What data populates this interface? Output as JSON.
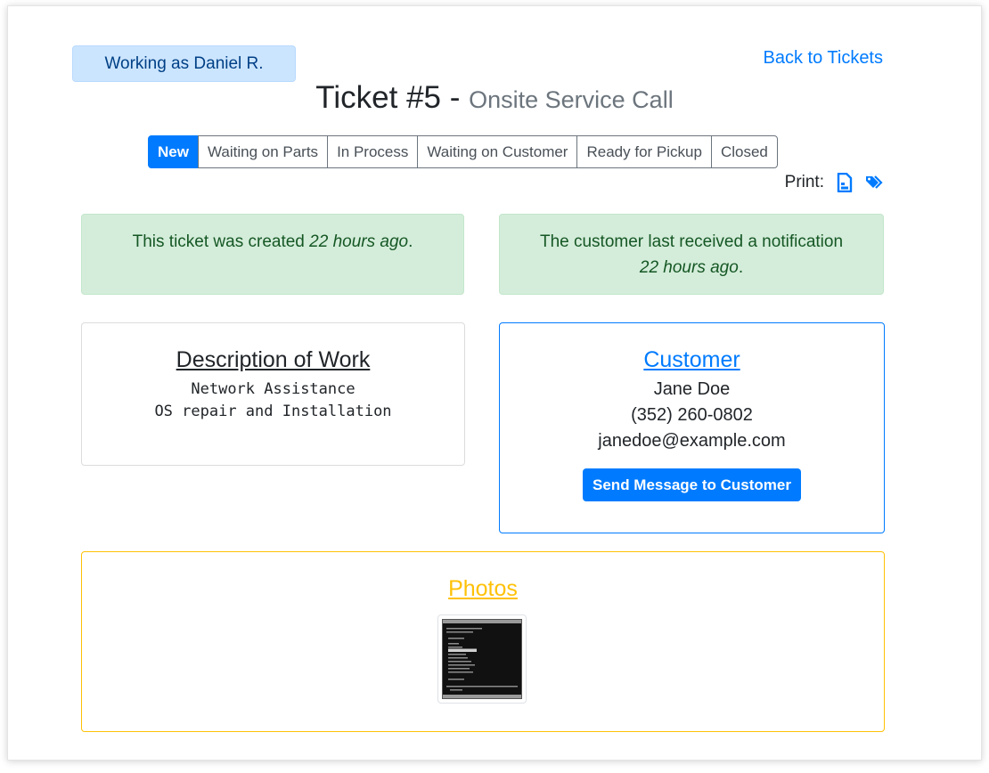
{
  "header": {
    "working_as": "Working as Daniel R.",
    "back_link": "Back to Tickets",
    "title_main": "Ticket #5 - ",
    "title_sub": "Onsite Service Call"
  },
  "statuses": [
    "New",
    "Waiting on Parts",
    "In Process",
    "Waiting on Customer",
    "Ready for Pickup",
    "Closed"
  ],
  "active_status": "New",
  "print": {
    "label": "Print:",
    "icons": [
      "document-print-icon",
      "tags-print-icon"
    ]
  },
  "alerts": {
    "created_prefix": "This ticket was created ",
    "created_time": "22 hours ago",
    "created_suffix": ".",
    "notify_prefix": "The customer last received a notification",
    "notify_time": "22 hours ago",
    "notify_suffix": "."
  },
  "description": {
    "heading": "Description of Work",
    "lines": [
      "Network Assistance",
      "OS repair and Installation"
    ]
  },
  "customer": {
    "heading": "Customer",
    "name": "Jane Doe",
    "phone": "(352) 260-0802",
    "email": "janedoe@example.com",
    "button": "Send Message to Customer"
  },
  "photos": {
    "heading": "Photos"
  },
  "colors": {
    "primary": "#007bff",
    "success_bg": "#d4edda",
    "success_text": "#155724",
    "warning": "#ffc107",
    "info_bg": "#cce5ff"
  }
}
